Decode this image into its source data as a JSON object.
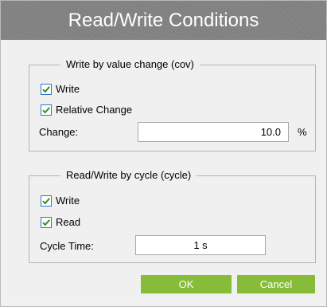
{
  "dialog": {
    "title": "Read/Write Conditions"
  },
  "cov_group": {
    "legend": "Write by value change (cov)",
    "write": {
      "label": "Write",
      "checked": true
    },
    "relative_change": {
      "label": "Relative Change",
      "checked": true
    },
    "change": {
      "label": "Change:",
      "value": "10.0",
      "unit": "%"
    }
  },
  "cycle_group": {
    "legend": "Read/Write by cycle (cycle)",
    "write": {
      "label": "Write",
      "checked": true
    },
    "read": {
      "label": "Read",
      "checked": true
    },
    "cycle_time": {
      "label": "Cycle Time:",
      "value": "1 s"
    }
  },
  "buttons": {
    "ok": "OK",
    "cancel": "Cancel"
  },
  "colors": {
    "accent_green": "#86bc37",
    "title_bar": "#7f7f7f",
    "check_blue": "#2f75c8",
    "check_mark": "#3a8f2c"
  }
}
